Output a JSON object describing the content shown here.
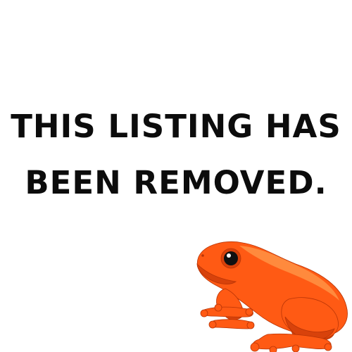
{
  "message": {
    "line1": "THIS LISTING HAS",
    "line2": "BEEN REMOVED."
  },
  "illustration": {
    "icon": "orange-frog-icon",
    "colors": {
      "body": "#ff5a14",
      "highlight": "#ff8a3d",
      "shadow": "#d8420b",
      "outline": "#b83406",
      "eye": "#111111"
    }
  }
}
